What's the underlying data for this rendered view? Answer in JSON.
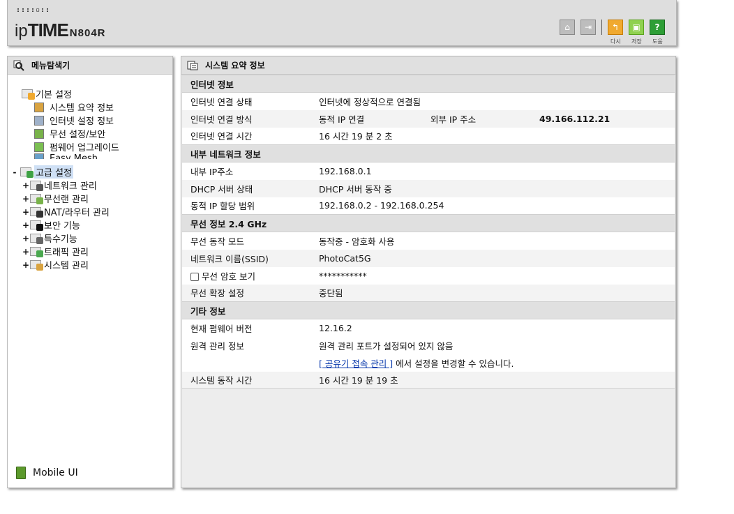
{
  "header": {
    "dots": "::::▫::",
    "brand_ip": "ip",
    "brand_time": "TIME",
    "brand_model": "N804R",
    "labels": {
      "back": "다시",
      "save": "저장",
      "help": "도움"
    }
  },
  "sidebar": {
    "title": "메뉴탐색기",
    "basic": {
      "label": "기본 설정",
      "items": [
        "시스템 요약 정보",
        "인터넷 설정 정보",
        "무선 설정/보안",
        "펌웨어 업그레이드",
        "Easy Mesh"
      ]
    },
    "advanced": {
      "toggle": "-",
      "label": "고급 설정",
      "items": [
        {
          "toggle": "+",
          "label": "네트워크 관리"
        },
        {
          "toggle": "+",
          "label": "무선랜 관리"
        },
        {
          "toggle": "+",
          "label": "NAT/라우터 관리"
        },
        {
          "toggle": "+",
          "label": "보안 기능"
        },
        {
          "toggle": "+",
          "label": "특수기능"
        },
        {
          "toggle": "+",
          "label": "트래픽 관리"
        },
        {
          "toggle": "+",
          "label": "시스템 관리"
        }
      ]
    },
    "mobile_ui": "Mobile UI"
  },
  "main": {
    "title": "시스템 요약 정보",
    "internet": {
      "section": "인터넷 정보",
      "status_label": "인터넷 연결 상태",
      "status_value": "인터넷에 정상적으로 연결됨",
      "method_label": "인터넷 연결 방식",
      "method_value": "동적 IP 연결",
      "ext_ip_label": "외부 IP 주소",
      "ext_ip_value": "49.166.112.21",
      "time_label": "인터넷 연결 시간",
      "time_value": "16 시간 19 분 2 초"
    },
    "lan": {
      "section": "내부 네트워크 정보",
      "ip_label": "내부 IP주소",
      "ip_value": "192.168.0.1",
      "dhcp_label": "DHCP 서버 상태",
      "dhcp_value": "DHCP 서버 동작 중",
      "range_label": "동적 IP 할당 범위",
      "range_value": "192.168.0.2 -  192.168.0.254"
    },
    "wireless": {
      "section": "무선 정보 2.4 GHz",
      "mode_label": "무선 동작 모드",
      "mode_value": "동작중 - 암호화 사용",
      "ssid_label": "네트워크 이름(SSID)",
      "ssid_value": "PhotoCat5G",
      "show_pw_label": "무선 암호 보기",
      "pw_value": "***********",
      "ext_label": "무선 확장 설정",
      "ext_value": "중단됨"
    },
    "etc": {
      "section": "기타 정보",
      "fw_label": "현재 펌웨어 버전",
      "fw_value": "12.16.2",
      "remote_label": "원격 관리 정보",
      "remote_value": "원격 관리 포트가 설정되어 있지 않음",
      "remote_link": "[ 공유기 접속 관리 ]",
      "remote_suffix": " 에서 설정을 변경할 수 있습니다.",
      "uptime_label": "시스템 동작 시간",
      "uptime_value": "16 시간 19 분 19 초"
    }
  }
}
